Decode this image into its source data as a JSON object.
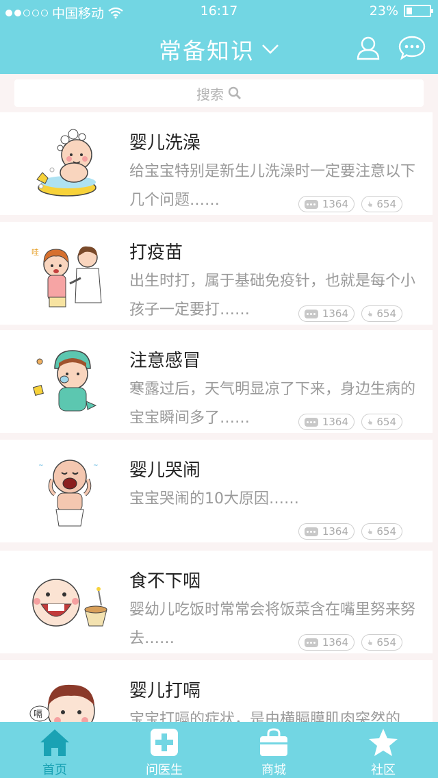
{
  "status_bar": {
    "carrier": "中国移动",
    "time": "16:17",
    "battery": "23%",
    "battery_level": 0.23
  },
  "header": {
    "title": "常备知识"
  },
  "search": {
    "label": "搜索"
  },
  "articles": [
    {
      "title": "婴儿洗澡",
      "desc": "给宝宝特别是新生儿洗澡时一定要注意以下几个问题……",
      "comments": "1364",
      "likes": "654",
      "icon": "baby-bath-illustration"
    },
    {
      "title": "打疫苗",
      "desc": "出生时打，属于基础免疫针，也就是每个小孩子一定要打……",
      "comments": "1364",
      "likes": "654",
      "icon": "vaccine-illustration"
    },
    {
      "title": "注意感冒",
      "desc": "寒露过后，天气明显凉了下来，身边生病的宝宝瞬间多了……",
      "comments": "1364",
      "likes": "654",
      "icon": "cold-illustration"
    },
    {
      "title": "婴儿哭闹",
      "desc": "宝宝哭闹的10大原因……",
      "comments": "1364",
      "likes": "654",
      "icon": "crying-baby-illustration"
    },
    {
      "title": "食不下咽",
      "desc": "婴幼儿吃饭时常常会将饭菜含在嘴里努来努去……",
      "comments": "1364",
      "likes": "654",
      "icon": "eating-illustration"
    },
    {
      "title": "婴儿打嗝",
      "desc": "宝宝打嗝的症状，是由横膈膜肌肉突然的",
      "comments": "",
      "likes": "",
      "icon": "hiccup-illustration",
      "hiccup_text": "嗝"
    }
  ],
  "tabbar": {
    "items": [
      {
        "label": "首页",
        "icon": "home-icon",
        "active": true
      },
      {
        "label": "问医生",
        "icon": "medical-cross-icon",
        "active": false
      },
      {
        "label": "商城",
        "icon": "shopping-bag-icon",
        "active": false
      },
      {
        "label": "社区",
        "icon": "star-icon",
        "active": false
      }
    ]
  },
  "colors": {
    "primary": "#72d6e3",
    "active_tab": "#1aa2b4",
    "background": "#faf3f3"
  }
}
